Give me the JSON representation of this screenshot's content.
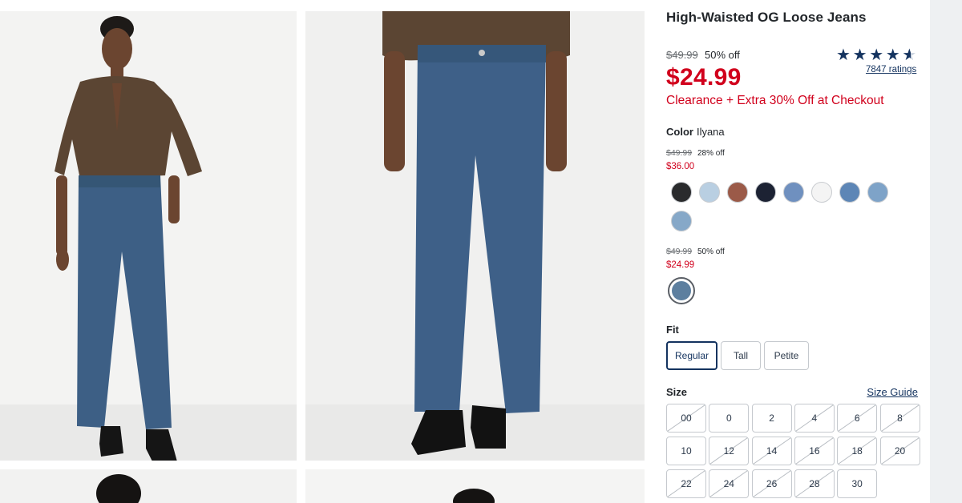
{
  "product": {
    "title": "High-Waisted OG Loose Jeans",
    "was_price": "$49.99",
    "discount": "50% off",
    "price": "$24.99",
    "promo": "Clearance + Extra 30% Off at Checkout",
    "rating_stars": 4.5,
    "ratings_count": "7847 ratings"
  },
  "color": {
    "label": "Color",
    "value": "Ilyana",
    "tiers": [
      {
        "was": "$49.99",
        "off": "28% off",
        "now": "$36.00",
        "swatches": [
          "#2a2b2d",
          "#b9cfe2",
          "#9b5a48",
          "#1c2233",
          "#6f90bf",
          "#f4f4f4",
          "#5d86b6",
          "#7ea3c8",
          "#86a8c8"
        ]
      },
      {
        "was": "$49.99",
        "off": "50% off",
        "now": "$24.99",
        "swatches": [
          "#5d7f9f"
        ]
      }
    ]
  },
  "fit": {
    "label": "Fit",
    "options": [
      "Regular",
      "Tall",
      "Petite"
    ],
    "selected": "Regular"
  },
  "size": {
    "label": "Size",
    "guide": "Size Guide",
    "options": [
      {
        "label": "00",
        "available": false
      },
      {
        "label": "0",
        "available": true
      },
      {
        "label": "2",
        "available": true
      },
      {
        "label": "4",
        "available": false
      },
      {
        "label": "6",
        "available": false
      },
      {
        "label": "8",
        "available": false
      },
      {
        "label": "10",
        "available": true
      },
      {
        "label": "12",
        "available": false
      },
      {
        "label": "14",
        "available": false
      },
      {
        "label": "16",
        "available": false
      },
      {
        "label": "18",
        "available": false
      },
      {
        "label": "20",
        "available": false
      },
      {
        "label": "22",
        "available": false
      },
      {
        "label": "24",
        "available": false
      },
      {
        "label": "26",
        "available": false
      },
      {
        "label": "28",
        "available": false
      },
      {
        "label": "30",
        "available": true
      }
    ]
  },
  "colors": {
    "sale_red": "#d1001c",
    "navy": "#14335f"
  },
  "icons": {
    "star": "star-icon",
    "half_star": "half-star-icon"
  }
}
